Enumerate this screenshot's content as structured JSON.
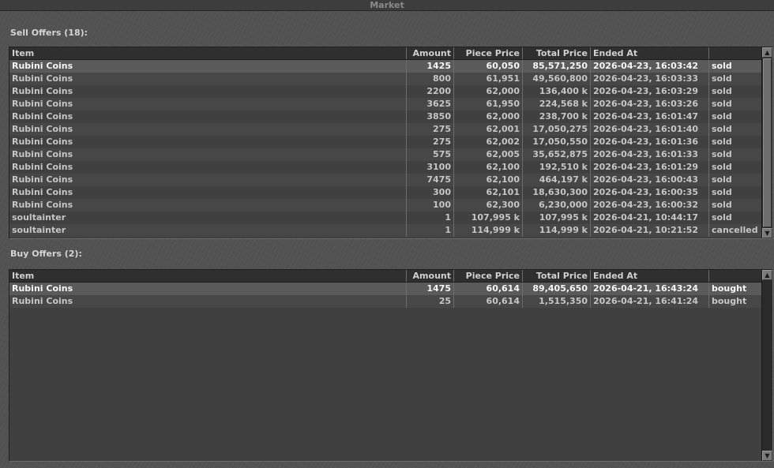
{
  "window": {
    "title": "Market"
  },
  "columns": {
    "item": "Item",
    "amount": "Amount",
    "piece_price": "Piece Price",
    "total_price": "Total Price",
    "ended_at": "Ended At",
    "status": ""
  },
  "sell": {
    "label": "Sell Offers (18):",
    "rows": [
      {
        "item": "Rubini Coins",
        "amount": "1425",
        "piece": "60,050",
        "total": "85,571,250",
        "ended": "2026-04-23, 16:03:42",
        "status": "sold"
      },
      {
        "item": "Rubini Coins",
        "amount": "800",
        "piece": "61,951",
        "total": "49,560,800",
        "ended": "2026-04-23, 16:03:33",
        "status": "sold"
      },
      {
        "item": "Rubini Coins",
        "amount": "2200",
        "piece": "62,000",
        "total": "136,400 k",
        "ended": "2026-04-23, 16:03:29",
        "status": "sold"
      },
      {
        "item": "Rubini Coins",
        "amount": "3625",
        "piece": "61,950",
        "total": "224,568 k",
        "ended": "2026-04-23, 16:03:26",
        "status": "sold"
      },
      {
        "item": "Rubini Coins",
        "amount": "3850",
        "piece": "62,000",
        "total": "238,700 k",
        "ended": "2026-04-23, 16:01:47",
        "status": "sold"
      },
      {
        "item": "Rubini Coins",
        "amount": "275",
        "piece": "62,001",
        "total": "17,050,275",
        "ended": "2026-04-23, 16:01:40",
        "status": "sold"
      },
      {
        "item": "Rubini Coins",
        "amount": "275",
        "piece": "62,002",
        "total": "17,050,550",
        "ended": "2026-04-23, 16:01:36",
        "status": "sold"
      },
      {
        "item": "Rubini Coins",
        "amount": "575",
        "piece": "62,005",
        "total": "35,652,875",
        "ended": "2026-04-23, 16:01:33",
        "status": "sold"
      },
      {
        "item": "Rubini Coins",
        "amount": "3100",
        "piece": "62,100",
        "total": "192,510 k",
        "ended": "2026-04-23, 16:01:29",
        "status": "sold"
      },
      {
        "item": "Rubini Coins",
        "amount": "7475",
        "piece": "62,100",
        "total": "464,197 k",
        "ended": "2026-04-23, 16:00:43",
        "status": "sold"
      },
      {
        "item": "Rubini Coins",
        "amount": "300",
        "piece": "62,101",
        "total": "18,630,300",
        "ended": "2026-04-23, 16:00:35",
        "status": "sold"
      },
      {
        "item": "Rubini Coins",
        "amount": "100",
        "piece": "62,300",
        "total": "6,230,000",
        "ended": "2026-04-23, 16:00:32",
        "status": "sold"
      },
      {
        "item": "soultainter",
        "amount": "1",
        "piece": "107,995 k",
        "total": "107,995 k",
        "ended": "2026-04-21, 10:44:17",
        "status": "sold"
      },
      {
        "item": "soultainter",
        "amount": "1",
        "piece": "114,999 k",
        "total": "114,999 k",
        "ended": "2026-04-21, 10:21:52",
        "status": "cancelled"
      }
    ]
  },
  "buy": {
    "label": "Buy Offers (2):",
    "rows": [
      {
        "item": "Rubini Coins",
        "amount": "1475",
        "piece": "60,614",
        "total": "89,405,650",
        "ended": "2026-04-21, 16:43:24",
        "status": "bought"
      },
      {
        "item": "Rubini Coins",
        "amount": "25",
        "piece": "60,614",
        "total": "1,515,350",
        "ended": "2026-04-21, 16:41:24",
        "status": "bought"
      }
    ]
  },
  "icons": {
    "scroll_up": "arrow-up-icon",
    "scroll_down": "arrow-down-icon"
  }
}
